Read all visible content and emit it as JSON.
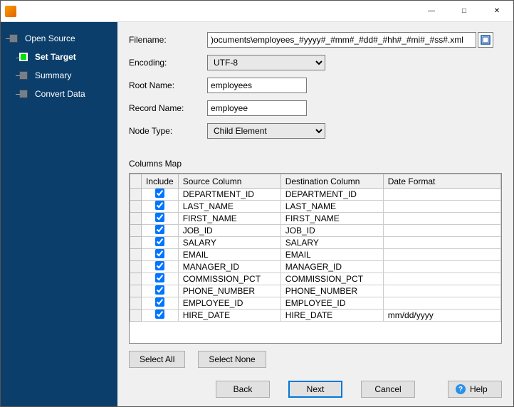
{
  "titlebar": {
    "minimize": "—",
    "maximize": "□",
    "close": "✕"
  },
  "sidebar": {
    "items": [
      {
        "label": "Open Source",
        "active": false
      },
      {
        "label": "Set Target",
        "active": true
      },
      {
        "label": "Summary",
        "active": false
      },
      {
        "label": "Convert Data",
        "active": false
      }
    ]
  },
  "form": {
    "filename_label": "Filename:",
    "filename_value": ")ocuments\\employees_#yyyy#_#mm#_#dd#_#hh#_#mi#_#ss#.xml",
    "encoding_label": "Encoding:",
    "encoding_value": "UTF-8",
    "root_label": "Root Name:",
    "root_value": "employees",
    "record_label": "Record Name:",
    "record_value": "employee",
    "nodetype_label": "Node Type:",
    "nodetype_value": "Child Element"
  },
  "columns_map": {
    "title": "Columns Map",
    "headers": {
      "include": "Include",
      "source": "Source Column",
      "dest": "Destination Column",
      "fmt": "Date Format"
    },
    "rows": [
      {
        "include": true,
        "source": "DEPARTMENT_ID",
        "dest": "DEPARTMENT_ID",
        "fmt": ""
      },
      {
        "include": true,
        "source": "LAST_NAME",
        "dest": "LAST_NAME",
        "fmt": ""
      },
      {
        "include": true,
        "source": "FIRST_NAME",
        "dest": "FIRST_NAME",
        "fmt": ""
      },
      {
        "include": true,
        "source": "JOB_ID",
        "dest": "JOB_ID",
        "fmt": ""
      },
      {
        "include": true,
        "source": "SALARY",
        "dest": "SALARY",
        "fmt": ""
      },
      {
        "include": true,
        "source": "EMAIL",
        "dest": "EMAIL",
        "fmt": ""
      },
      {
        "include": true,
        "source": "MANAGER_ID",
        "dest": "MANAGER_ID",
        "fmt": ""
      },
      {
        "include": true,
        "source": "COMMISSION_PCT",
        "dest": "COMMISSION_PCT",
        "fmt": ""
      },
      {
        "include": true,
        "source": "PHONE_NUMBER",
        "dest": "PHONE_NUMBER",
        "fmt": ""
      },
      {
        "include": true,
        "source": "EMPLOYEE_ID",
        "dest": "EMPLOYEE_ID",
        "fmt": ""
      },
      {
        "include": true,
        "source": "HIRE_DATE",
        "dest": "HIRE_DATE",
        "fmt": "mm/dd/yyyy"
      }
    ]
  },
  "buttons": {
    "select_all": "Select All",
    "select_none": "Select None",
    "back": "Back",
    "next": "Next",
    "cancel": "Cancel",
    "help": "Help"
  }
}
